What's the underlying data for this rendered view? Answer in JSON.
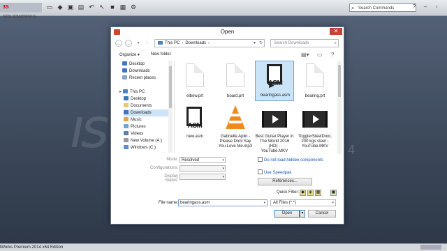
{
  "app": {
    "brand": "SOLIDWORKS",
    "brand_prefix": "3S",
    "search_placeholder": "Search Commands",
    "status_text": "lWorks Premium 2014 x64 Edition",
    "quick_access_icons": [
      "new-icon",
      "open-icon",
      "save-icon",
      "print-icon",
      "undo-icon",
      "select-icon",
      "rebuild-icon",
      "file-properties-icon",
      "options-icon"
    ]
  },
  "dialog": {
    "title": "Open",
    "address": {
      "root": "This PC",
      "folder": "Downloads"
    },
    "search_placeholder": "Search Downloads",
    "toolbar": {
      "organize": "Organize ▾",
      "new_folder": "New folder"
    },
    "nav": [
      "Desktop",
      "Downloads",
      "Recent places",
      "This PC",
      "Desktop",
      "Documents",
      "Downloads",
      "Music",
      "Pictures",
      "Videos",
      "New Volume (A:)",
      "Windows (C:)"
    ],
    "nav_selected_index": 6,
    "files": [
      {
        "name": "elbow.prt",
        "kind": "doc"
      },
      {
        "name": "board.prt",
        "kind": "doc"
      },
      {
        "name": "bearingass.asm",
        "kind": "asm",
        "selected": true
      },
      {
        "name": "bearing.prt",
        "kind": "doc"
      },
      {
        "name": "new.asm",
        "kind": "asm"
      },
      {
        "name": "Gabrielle Aplin - Please Dont Say You Love Me.mp3",
        "kind": "vlc"
      },
      {
        "name": "Best Guitar Player in The World 2016 (HD) - YouTube.MKV",
        "kind": "video"
      },
      {
        "name": "TogglerSteelDoor, 200 kgs steel - YouTube.MKV",
        "kind": "video"
      }
    ],
    "asm_label": "ASM",
    "options": {
      "mode_label": "Mode:",
      "mode_value": "Resolved",
      "configurations_label": "Configurations:",
      "display_states_label": "Display States:",
      "do_not_load_hidden": "Do not load hidden components",
      "use_speedpak": "Use Speedpak",
      "references_button": "References..."
    },
    "quick_filter_label": "Quick Filter:",
    "file_name_label": "File name:",
    "file_name_value": "bearingass.asm",
    "file_type": "All Files (*.*)",
    "open_button": "Open",
    "cancel_button": "Cancel"
  }
}
